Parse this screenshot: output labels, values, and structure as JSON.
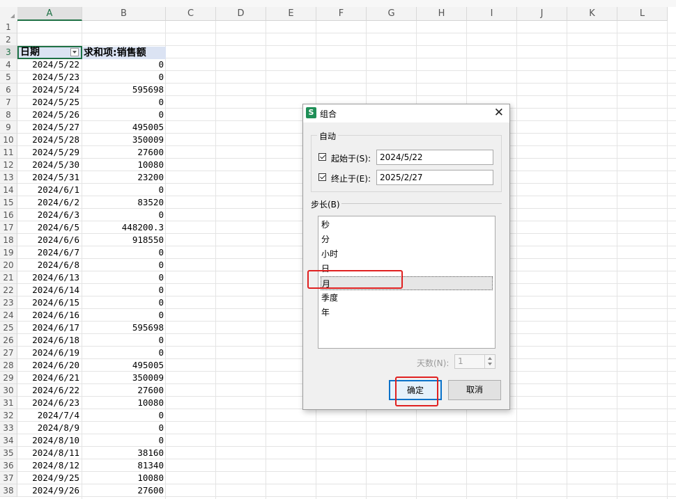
{
  "sheet": {
    "columns": [
      "A",
      "B",
      "C",
      "D",
      "E",
      "F",
      "G",
      "H",
      "I",
      "J",
      "K",
      "L"
    ],
    "rows": [
      "1",
      "2",
      "3",
      "4",
      "5",
      "6",
      "7",
      "8",
      "9",
      "10",
      "11",
      "12",
      "13",
      "14",
      "15",
      "16",
      "17",
      "18",
      "19",
      "20",
      "21",
      "22",
      "23",
      "24",
      "25",
      "26",
      "27",
      "28",
      "29",
      "30",
      "31",
      "32",
      "33",
      "34",
      "35",
      "36",
      "37",
      "38"
    ],
    "pivot_header": {
      "date": "日期",
      "sum": "求和项:销售额"
    },
    "data": [
      [
        "2024/5/22",
        "0"
      ],
      [
        "2024/5/23",
        "0"
      ],
      [
        "2024/5/24",
        "595698"
      ],
      [
        "2024/5/25",
        "0"
      ],
      [
        "2024/5/26",
        "0"
      ],
      [
        "2024/5/27",
        "495005"
      ],
      [
        "2024/5/28",
        "350009"
      ],
      [
        "2024/5/29",
        "27600"
      ],
      [
        "2024/5/30",
        "10080"
      ],
      [
        "2024/5/31",
        "23200"
      ],
      [
        "2024/6/1",
        "0"
      ],
      [
        "2024/6/2",
        "83520"
      ],
      [
        "2024/6/3",
        "0"
      ],
      [
        "2024/6/5",
        "448200.3"
      ],
      [
        "2024/6/6",
        "918550"
      ],
      [
        "2024/6/7",
        "0"
      ],
      [
        "2024/6/8",
        "0"
      ],
      [
        "2024/6/13",
        "0"
      ],
      [
        "2024/6/14",
        "0"
      ],
      [
        "2024/6/15",
        "0"
      ],
      [
        "2024/6/16",
        "0"
      ],
      [
        "2024/6/17",
        "595698"
      ],
      [
        "2024/6/18",
        "0"
      ],
      [
        "2024/6/19",
        "0"
      ],
      [
        "2024/6/20",
        "495005"
      ],
      [
        "2024/6/21",
        "350009"
      ],
      [
        "2024/6/22",
        "27600"
      ],
      [
        "2024/6/23",
        "10080"
      ],
      [
        "2024/7/4",
        "0"
      ],
      [
        "2024/8/9",
        "0"
      ],
      [
        "2024/8/10",
        "0"
      ],
      [
        "2024/8/11",
        "38160"
      ],
      [
        "2024/8/12",
        "81340"
      ],
      [
        "2024/9/25",
        "10080"
      ],
      [
        "2024/9/26",
        "27600"
      ]
    ]
  },
  "dialog": {
    "app_icon": "S",
    "title": "组合",
    "auto_group_label": "自动",
    "start_label": "起始于(S):",
    "start_value": "2024/5/22",
    "end_label": "终止于(E):",
    "end_value": "2025/2/27",
    "step_label": "步长(B)",
    "step_options": [
      "秒",
      "分",
      "小时",
      "日",
      "月",
      "季度",
      "年"
    ],
    "selected_option": "月",
    "days_label": "天数(N):",
    "days_value": "1",
    "ok_label": "确定",
    "cancel_label": "取消",
    "close_symbol": "✕",
    "highlight_color": "#e02020"
  }
}
